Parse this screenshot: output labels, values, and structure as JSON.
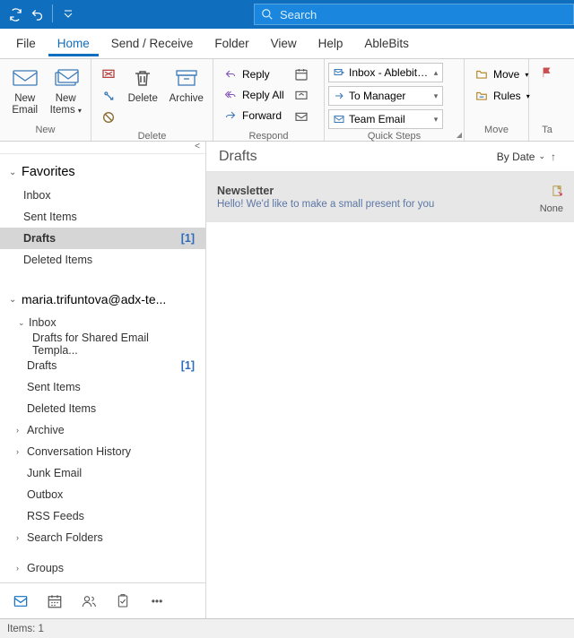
{
  "search": {
    "placeholder": "Search"
  },
  "menu": {
    "file": "File",
    "home": "Home",
    "sendrecv": "Send / Receive",
    "folder": "Folder",
    "view": "View",
    "help": "Help",
    "ablebits": "AbleBits"
  },
  "ribbon": {
    "new_group": "New",
    "new_email": "New\nEmail",
    "new_items": "New\nItems",
    "delete_group": "Delete",
    "delete": "Delete",
    "archive": "Archive",
    "respond_group": "Respond",
    "reply": "Reply",
    "reply_all": "Reply All",
    "forward": "Forward",
    "quicksteps_group": "Quick Steps",
    "qs_inbox": "Inbox - Ablebits...",
    "qs_manager": "To Manager",
    "qs_team": "Team Email",
    "move_group": "Move",
    "move": "Move",
    "rules": "Rules",
    "tags_stub": "Ta"
  },
  "nav": {
    "favorites": "Favorites",
    "fav_items": [
      {
        "label": "Inbox",
        "count": ""
      },
      {
        "label": "Sent Items",
        "count": ""
      },
      {
        "label": "Drafts",
        "count": "[1]",
        "selected": true
      },
      {
        "label": "Deleted Items",
        "count": ""
      }
    ],
    "account": "maria.trifuntova@adx-te...",
    "acct_tree": {
      "inbox": "Inbox",
      "drafts_shared": "Drafts for Shared Email Templa...",
      "drafts": {
        "label": "Drafts",
        "count": "[1]"
      },
      "sent": "Sent Items",
      "deleted": "Deleted Items",
      "archive": "Archive",
      "convo": "Conversation History",
      "junk": "Junk Email",
      "outbox": "Outbox",
      "rss": "RSS Feeds",
      "search": "Search Folders",
      "groups": "Groups"
    }
  },
  "list": {
    "title": "Drafts",
    "sort": "By Date",
    "items": [
      {
        "subject": "Newsletter",
        "preview": "Hello!  We'd like to make a small present for you",
        "category": "None"
      }
    ]
  },
  "status": {
    "items": "Items: 1"
  }
}
